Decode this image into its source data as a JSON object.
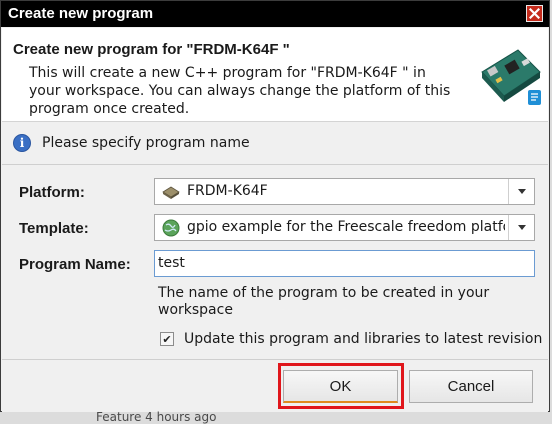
{
  "window": {
    "title": "Create new program"
  },
  "header": {
    "title": "Create new program for \"FRDM-K64F \"",
    "description": "This will create a new C++ program for \"FRDM-K64F \" in your workspace. You can always change the platform of this program once created."
  },
  "info": {
    "message": "Please specify program name"
  },
  "form": {
    "platform_label": "Platform:",
    "platform_value": "FRDM-K64F",
    "template_label": "Template:",
    "template_value": "gpio example for the Freescale freedom platform",
    "name_label": "Program Name:",
    "name_value": "test",
    "name_hint": "The name of the program to be created in your workspace",
    "update_label": "Update this program and libraries to latest revision",
    "update_checked": true
  },
  "buttons": {
    "ok": "OK",
    "cancel": "Cancel"
  },
  "background_text": "Feature 4 hours ago",
  "colors": {
    "highlight": "#e0161b",
    "close": "#c42b1c",
    "titlebar": "#000000"
  },
  "icons": [
    "close-icon",
    "board-icon",
    "info-icon",
    "chip-icon",
    "globe-icon",
    "dropdown-arrow-icon",
    "check-icon"
  ]
}
